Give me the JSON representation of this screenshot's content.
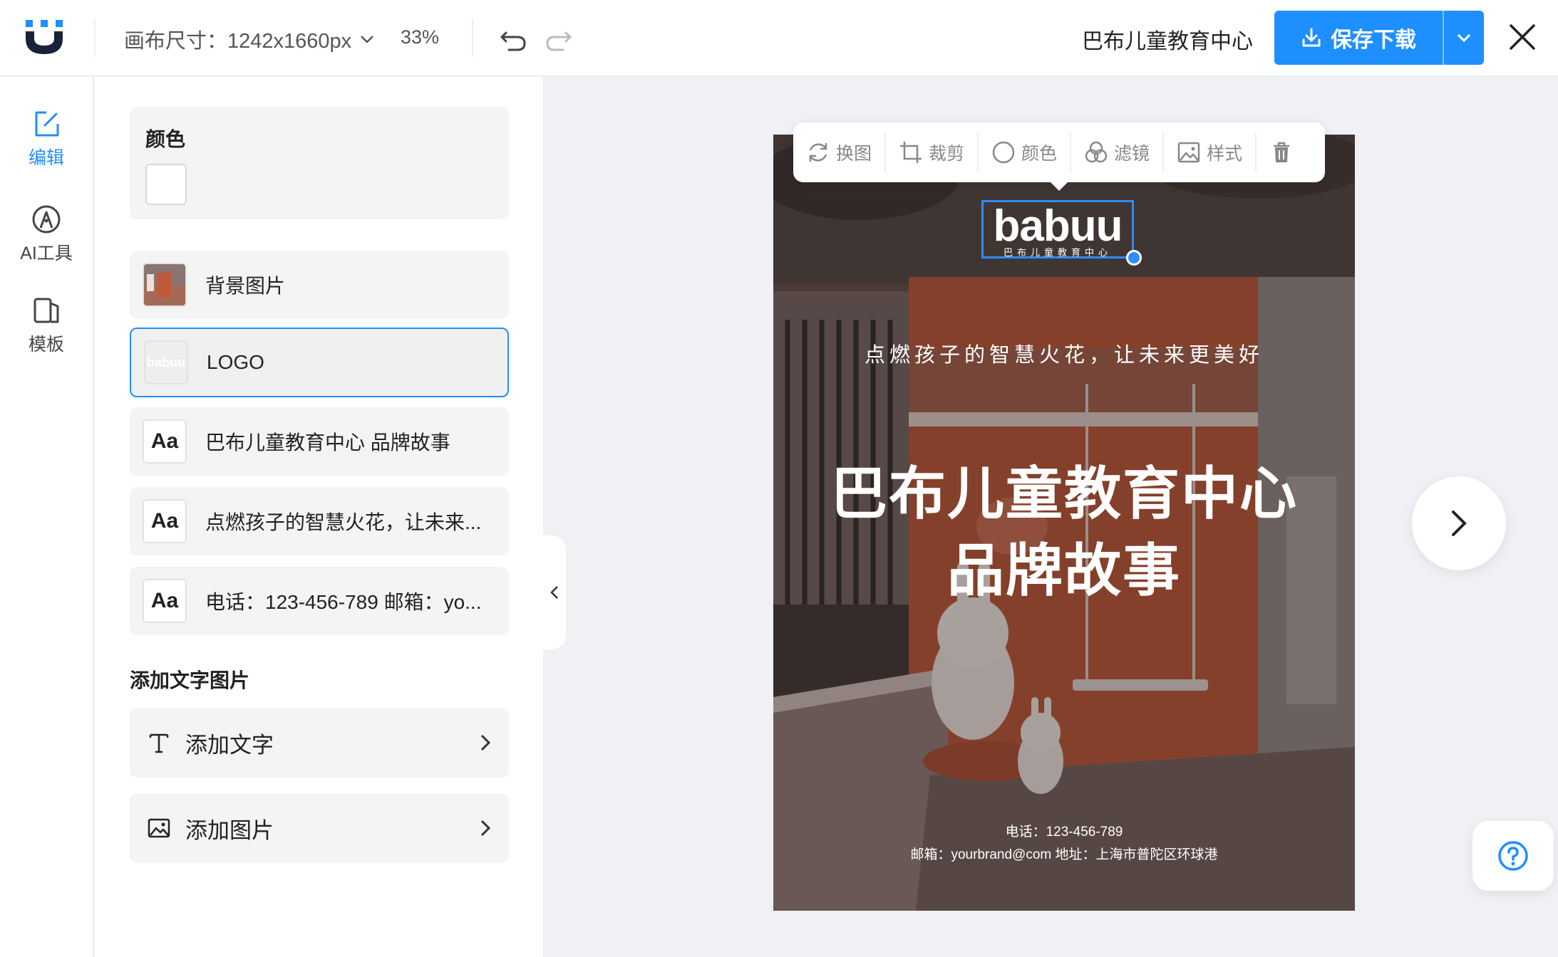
{
  "header": {
    "canvas_size_label": "画布尺寸：1242x1660px",
    "zoom": "33%",
    "brand_name": "巴布儿童教育中心",
    "save_label": "保存下载"
  },
  "leftnav": {
    "items": [
      {
        "label": "编辑",
        "icon": "edit-icon",
        "active": true
      },
      {
        "label": "AI工具",
        "icon": "pen-nib-icon",
        "active": false
      },
      {
        "label": "模板",
        "icon": "template-icon",
        "active": false
      }
    ]
  },
  "panel": {
    "color_title": "颜色",
    "color_value": "#ffffff",
    "layers": [
      {
        "label": "背景图片",
        "thumb": "image"
      },
      {
        "label": "LOGO",
        "thumb": "logo",
        "selected": true
      },
      {
        "label": "巴布儿童教育中心 品牌故事",
        "thumb": "Aa"
      },
      {
        "label": "点燃孩子的智慧火花，让未来...",
        "thumb": "Aa"
      },
      {
        "label": "电话：123-456-789 邮箱：yo...",
        "thumb": "Aa"
      }
    ],
    "section_title": "添加文字图片",
    "add_text": "添加文字",
    "add_image": "添加图片"
  },
  "toolbar": {
    "items": [
      {
        "label": "换图",
        "icon": "refresh-icon"
      },
      {
        "label": "裁剪",
        "icon": "crop-icon"
      },
      {
        "label": "颜色",
        "icon": "circle-icon"
      },
      {
        "label": "滤镜",
        "icon": "filter-icon"
      },
      {
        "label": "样式",
        "icon": "image-style-icon"
      }
    ],
    "delete_icon": "trash-icon"
  },
  "poster": {
    "logo_word": "babuu",
    "logo_sub": "巴布儿童教育中心",
    "tagline": "点燃孩子的智慧火花，让未来更美好",
    "title_line1": "巴布儿童教育中心",
    "title_line2": "品牌故事",
    "contact_line1": "电话：123-456-789",
    "contact_line2": "邮箱：yourbrand@com 地址：上海市普陀区环球港"
  },
  "colors": {
    "accent": "#1e8fff",
    "poster_orange": "#c2583a",
    "workspace_bg": "#eff1f4"
  }
}
